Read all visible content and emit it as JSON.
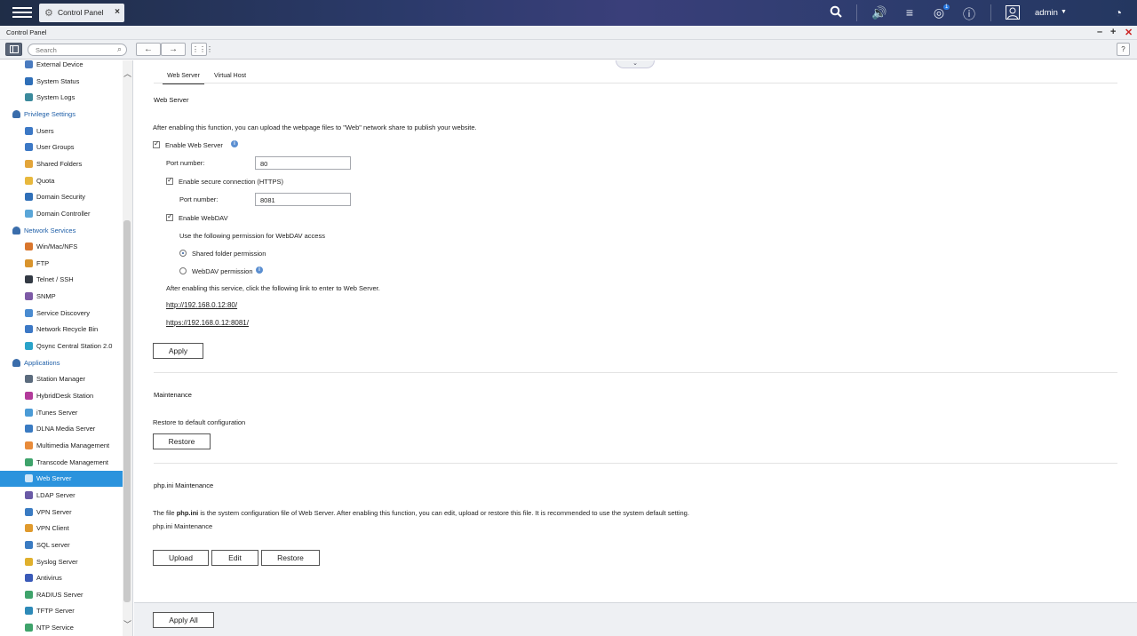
{
  "topbar": {
    "app_tab_label": "Control Panel",
    "user": "admin",
    "notification_count": "1"
  },
  "window": {
    "title": "Control Panel"
  },
  "toolbar": {
    "search_placeholder": "Search",
    "help": "?"
  },
  "sidebar": {
    "items": [
      {
        "label": "External Device",
        "type": "item",
        "color": "#4a7bbf"
      },
      {
        "label": "System Status",
        "type": "item",
        "color": "#2f6fb8"
      },
      {
        "label": "System Logs",
        "type": "item",
        "color": "#3b8a9c"
      },
      {
        "label": "Privilege Settings",
        "type": "category",
        "color": "#3a6dab"
      },
      {
        "label": "Users",
        "type": "item",
        "color": "#3c78c5"
      },
      {
        "label": "User Groups",
        "type": "item",
        "color": "#3c78c5"
      },
      {
        "label": "Shared Folders",
        "type": "item",
        "color": "#e3a53a"
      },
      {
        "label": "Quota",
        "type": "item",
        "color": "#e8b83d"
      },
      {
        "label": "Domain Security",
        "type": "item",
        "color": "#2f6fb8"
      },
      {
        "label": "Domain Controller",
        "type": "item",
        "color": "#5aa6d8"
      },
      {
        "label": "Network Services",
        "type": "category",
        "color": "#3a6dab"
      },
      {
        "label": "Win/Mac/NFS",
        "type": "item",
        "color": "#d9762d"
      },
      {
        "label": "FTP",
        "type": "item",
        "color": "#d9942d"
      },
      {
        "label": "Telnet / SSH",
        "type": "item",
        "color": "#333a44"
      },
      {
        "label": "SNMP",
        "type": "item",
        "color": "#7d5aa6"
      },
      {
        "label": "Service Discovery",
        "type": "item",
        "color": "#4a8bd0"
      },
      {
        "label": "Network Recycle Bin",
        "type": "item",
        "color": "#3c78c5"
      },
      {
        "label": "Qsync Central Station 2.0",
        "type": "item",
        "color": "#2aa3c9"
      },
      {
        "label": "Applications",
        "type": "category",
        "color": "#3a6dab"
      },
      {
        "label": "Station Manager",
        "type": "item",
        "color": "#5b6b7d"
      },
      {
        "label": "HybridDesk Station",
        "type": "item",
        "color": "#b23a9a"
      },
      {
        "label": "iTunes Server",
        "type": "item",
        "color": "#4b9bd6"
      },
      {
        "label": "DLNA Media Server",
        "type": "item",
        "color": "#3a7bc2"
      },
      {
        "label": "Multimedia Management",
        "type": "item",
        "color": "#e88b3a"
      },
      {
        "label": "Transcode Management",
        "type": "item",
        "color": "#3fa36b"
      },
      {
        "label": "Web Server",
        "type": "item",
        "color": "#ffffff",
        "active": true
      },
      {
        "label": "LDAP Server",
        "type": "item",
        "color": "#6a5aa6"
      },
      {
        "label": "VPN Server",
        "type": "item",
        "color": "#3a7bc2"
      },
      {
        "label": "VPN Client",
        "type": "item",
        "color": "#e09a2d"
      },
      {
        "label": "SQL server",
        "type": "item",
        "color": "#3a7bc2"
      },
      {
        "label": "Syslog Server",
        "type": "item",
        "color": "#e0b02d"
      },
      {
        "label": "Antivirus",
        "type": "item",
        "color": "#3a5ab8"
      },
      {
        "label": "RADIUS Server",
        "type": "item",
        "color": "#3fa36b"
      },
      {
        "label": "TFTP Server",
        "type": "item",
        "color": "#2e8ab8"
      },
      {
        "label": "NTP Service",
        "type": "item",
        "color": "#3fa36b"
      }
    ]
  },
  "tabs": [
    {
      "label": "Web Server",
      "active": true
    },
    {
      "label": "Virtual Host",
      "active": false
    }
  ],
  "web_server": {
    "title": "Web Server",
    "description": "After enabling this function, you can upload the webpage files to \"Web\" network share to publish your website.",
    "enable_label": "Enable Web Server",
    "port_label": "Port number:",
    "port_value": "80",
    "https_label": "Enable secure connection (HTTPS)",
    "https_port_label": "Port number:",
    "https_port_value": "8081",
    "webdav_label": "Enable WebDAV",
    "webdav_permission_text": "Use the following permission for WebDAV access",
    "perm_shared_label": "Shared folder permission",
    "perm_webdav_label": "WebDAV permission",
    "link_intro": "After enabling this service, click the following link to enter to Web Server.",
    "link_http": "http://192.168.0.12:80/",
    "link_https": "https://192.168.0.12:8081/",
    "apply_label": "Apply"
  },
  "maintenance": {
    "title": "Maintenance",
    "text": "Restore to default configuration",
    "restore_label": "Restore"
  },
  "php": {
    "title": "php.ini Maintenance",
    "desc_pre": "The file ",
    "desc_file": "php.ini",
    "desc_post": " is the system configuration file of Web Server. After enabling this function, you can edit, upload or restore this file. It is recommended to use the system default setting.",
    "sub_label": "php.ini Maintenance",
    "upload_label": "Upload",
    "edit_label": "Edit",
    "restore_label": "Restore"
  },
  "footer": {
    "apply_all_label": "Apply All"
  }
}
